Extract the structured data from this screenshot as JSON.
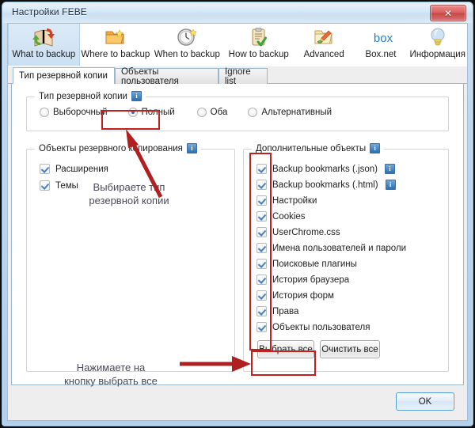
{
  "window": {
    "title": "Настройки FEBE",
    "close_label": "✕"
  },
  "toolbar": {
    "items": [
      {
        "label": "What to backup",
        "icon": "book-arrow-icon",
        "selected": true
      },
      {
        "label": "Where to backup",
        "icon": "folder-icon",
        "selected": false
      },
      {
        "label": "When to backup",
        "icon": "clock-icon",
        "selected": false
      },
      {
        "label": "How to backup",
        "icon": "clipboard-check-icon",
        "selected": false
      },
      {
        "label": "Advanced",
        "icon": "folder-tools-icon",
        "selected": false
      },
      {
        "label": "Box.net",
        "icon": "box-logo-icon",
        "selected": false
      },
      {
        "label": "Информация",
        "icon": "lightbulb-icon",
        "selected": false
      }
    ]
  },
  "tabs": [
    {
      "label": "Тип резервной копии",
      "active": true
    },
    {
      "label": "Объекты пользователя",
      "active": false
    },
    {
      "label": "Ignore list",
      "active": false
    }
  ],
  "backup_type_group": {
    "title": "Тип резервной копии",
    "info_icon": "i",
    "options": [
      {
        "label": "Выборочный",
        "selected": false
      },
      {
        "label": "Полный",
        "selected": true
      },
      {
        "label": "Оба",
        "selected": false
      },
      {
        "label": "Альтернативный",
        "selected": false
      }
    ]
  },
  "backup_objects_group": {
    "title": "Объекты резервного копирования",
    "info_icon": "i",
    "items": [
      {
        "label": "Расширения",
        "checked": true
      },
      {
        "label": "Темы",
        "checked": true
      }
    ]
  },
  "additional_objects_group": {
    "title": "Дополнительные объекты",
    "info_icon": "i",
    "items": [
      {
        "label": "Backup bookmarks (.json)",
        "checked": true,
        "info": true
      },
      {
        "label": "Backup bookmarks (.html)",
        "checked": true,
        "info": true
      },
      {
        "label": "Настройки",
        "checked": true,
        "info": false
      },
      {
        "label": "Cookies",
        "checked": true,
        "info": false
      },
      {
        "label": "UserChrome.css",
        "checked": true,
        "info": false
      },
      {
        "label": "Имена пользователей и пароли",
        "checked": true,
        "info": false
      },
      {
        "label": "Поисковые плагины",
        "checked": true,
        "info": false
      },
      {
        "label": "История браузера",
        "checked": true,
        "info": false
      },
      {
        "label": "История форм",
        "checked": true,
        "info": false
      },
      {
        "label": "Права",
        "checked": true,
        "info": false
      },
      {
        "label": "Объекты пользователя",
        "checked": true,
        "info": false
      }
    ],
    "select_all_label": "Выбрать все",
    "clear_all_label": "Очистить все"
  },
  "annotations": [
    {
      "text": "Выбираете тип\nрезервной копии"
    },
    {
      "text": "Нажимаете на\nкнопку выбрать все"
    }
  ],
  "footer": {
    "ok_label": "OK"
  },
  "colors": {
    "highlight": "#c0201f",
    "annotation_text": "#4a4a5a",
    "accent": "#2a6ec4"
  }
}
